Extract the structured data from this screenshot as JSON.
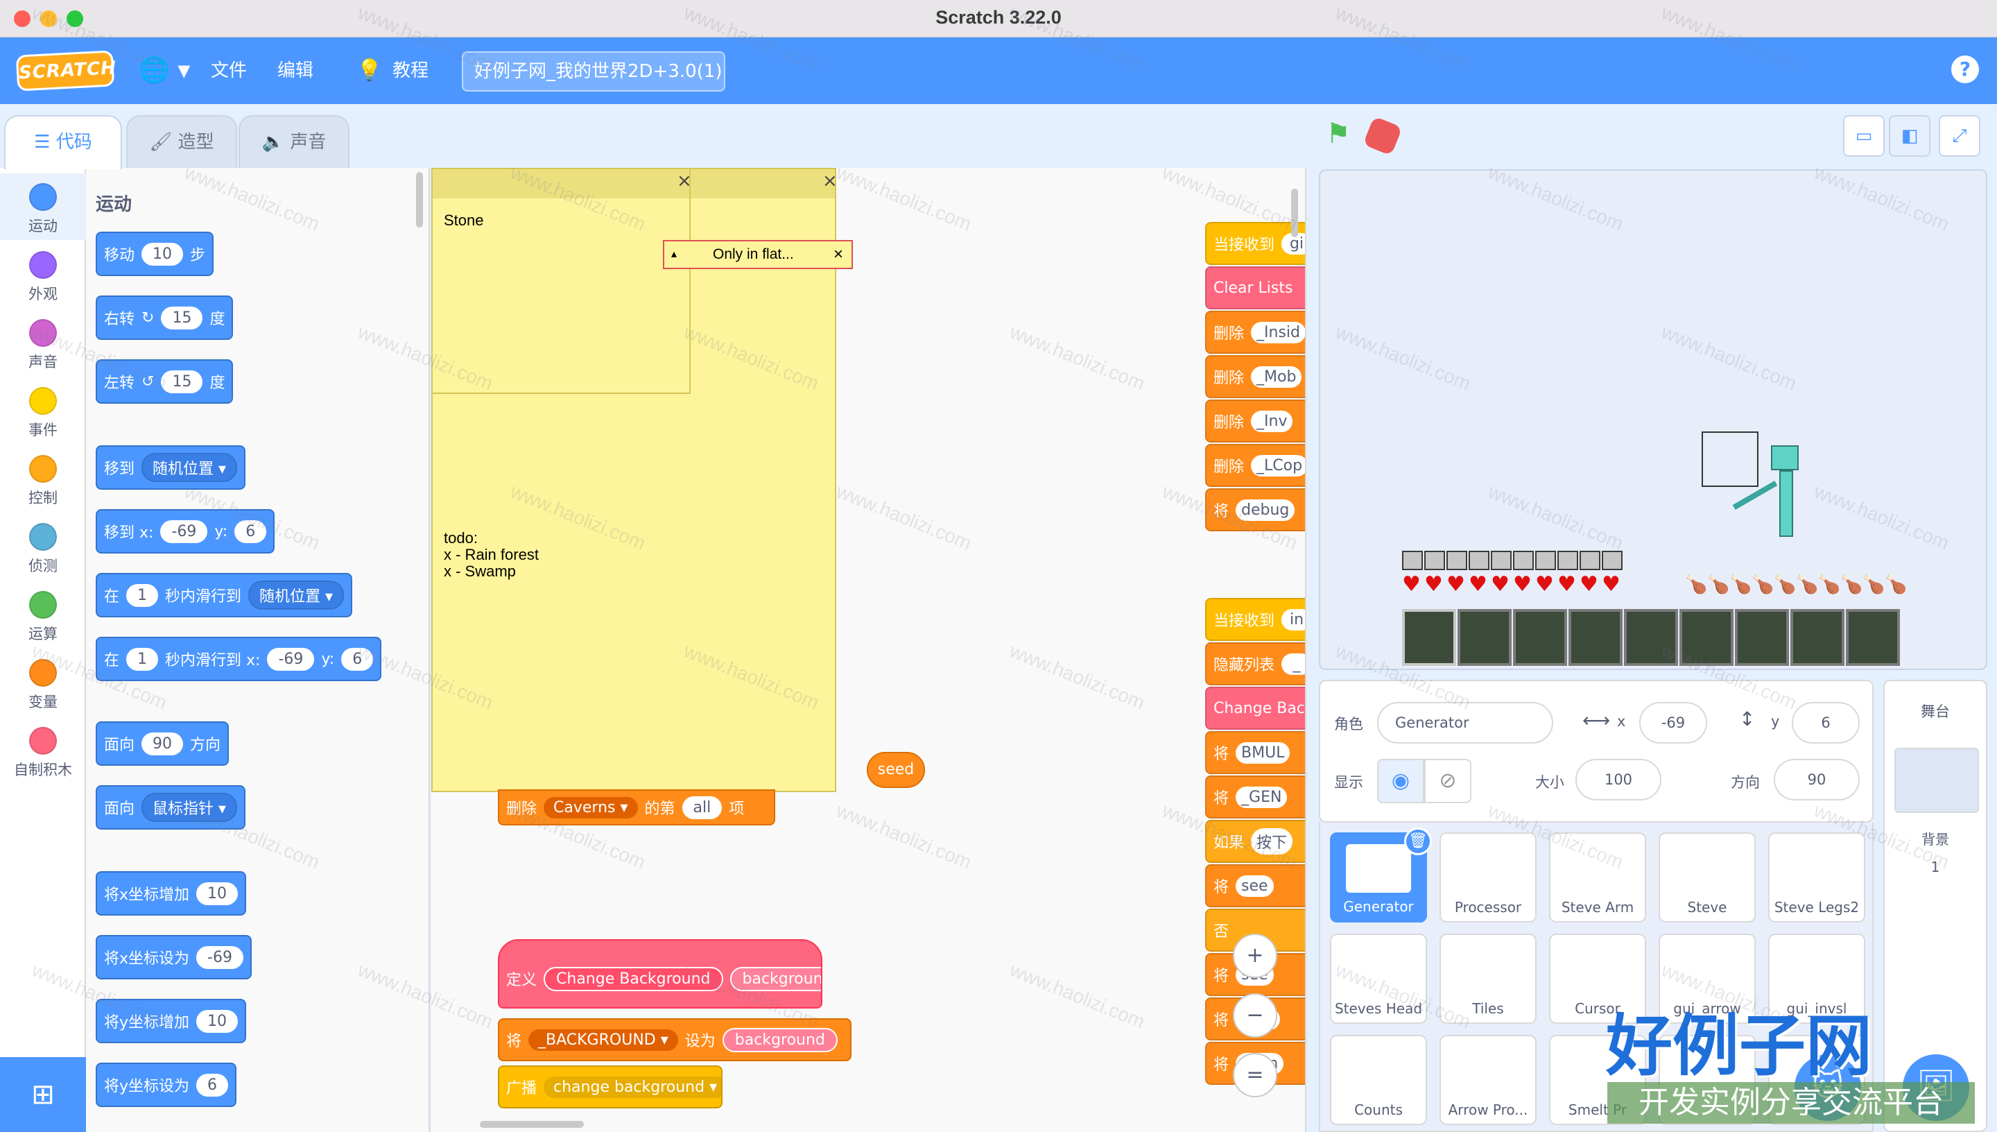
{
  "window": {
    "title": "Scratch 3.22.0"
  },
  "menubar": {
    "logo": "SCRATCH",
    "file": "文件",
    "edit": "编辑",
    "tutorials": "教程",
    "project_title": "好例子网_我的世界2D+3.0(1)",
    "help": "?"
  },
  "tabs": {
    "code": "代码",
    "costumes": "造型",
    "sounds": "声音"
  },
  "categories": [
    {
      "label": "运动",
      "color": "#4c97ff"
    },
    {
      "label": "外观",
      "color": "#9966ff"
    },
    {
      "label": "声音",
      "color": "#cf63cf"
    },
    {
      "label": "事件",
      "color": "#ffd500"
    },
    {
      "label": "控制",
      "color": "#ffab19"
    },
    {
      "label": "侦测",
      "color": "#5cb1d6"
    },
    {
      "label": "运算",
      "color": "#59c059"
    },
    {
      "label": "变量",
      "color": "#ff8c1a"
    },
    {
      "label": "自制积木",
      "color": "#ff6680"
    }
  ],
  "palette": {
    "title": "运动",
    "move": {
      "a": "移动",
      "v": "10",
      "b": "步"
    },
    "turn_right": {
      "a": "右转",
      "v": "15",
      "b": "度"
    },
    "turn_left": {
      "a": "左转",
      "v": "15",
      "b": "度"
    },
    "goto": {
      "a": "移到",
      "dd": "随机位置"
    },
    "goto_xy": {
      "a": "移到 x:",
      "x": "-69",
      "b": "y:",
      "y": "6"
    },
    "glide": {
      "a": "在",
      "v": "1",
      "b": "秒内滑行到",
      "dd": "随机位置"
    },
    "glide_xy": {
      "a": "在",
      "v": "1",
      "b": "秒内滑行到 x:",
      "x": "-69",
      "c": "y:",
      "y": "6"
    },
    "point_dir": {
      "a": "面向",
      "v": "90",
      "b": "方向"
    },
    "point_towards": {
      "a": "面向",
      "dd": "鼠标指针"
    },
    "change_x": {
      "a": "将x坐标增加",
      "v": "10"
    },
    "set_x": {
      "a": "将x坐标设为",
      "v": "-69"
    },
    "change_y": {
      "a": "将y坐标增加",
      "v": "10"
    },
    "set_y": {
      "a": "将y坐标设为",
      "v": "6"
    }
  },
  "script": {
    "note1": "Stone",
    "note2": "todo:\nx - Rain forest\nx - Swamp",
    "note_small": "Only in flat...",
    "delete_block": {
      "a": "删除",
      "dd": "Caverns",
      "b": "的第",
      "v": "all",
      "c": "项"
    },
    "seed": "seed",
    "define": {
      "a": "定义",
      "name": "Change Background",
      "arg": "background"
    },
    "set_bg": {
      "a": "将",
      "dd": "_BACKGROUND",
      "b": "设为",
      "v": "background"
    },
    "broadcast": {
      "a": "广播",
      "dd": "change background"
    },
    "right_stack1": [
      "当接收到",
      "Clear Lists",
      "删除",
      "删除",
      "删除",
      "删除",
      "将"
    ],
    "right_stack1_args": [
      "gi",
      "",
      "_Insid",
      "_Mob",
      "_Inv",
      "_LCop",
      "debug"
    ],
    "right_stack2": [
      "当接收到",
      "隐藏列表",
      "Change Back",
      "将",
      "将",
      "如果",
      "将",
      "否",
      "将",
      "将",
      "将"
    ],
    "right_stack2_args": [
      "in",
      "_",
      "",
      "BMUL",
      "_GEN",
      "按下",
      "see",
      "",
      "see",
      "CHU",
      "_Ran"
    ],
    "zoom_in": "+",
    "zoom_out": "−",
    "zoom_reset": "="
  },
  "sprite_info": {
    "sprite_label": "角色",
    "sprite_name": "Generator",
    "x_label": "x",
    "x": "-69",
    "y_label": "y",
    "y": "6",
    "show_label": "显示",
    "size_label": "大小",
    "size": "100",
    "direction_label": "方向",
    "direction": "90"
  },
  "sprites": [
    "Generator",
    "Processor",
    "Steve Arm",
    "Steve",
    "Steve Legs2",
    "Steves Head",
    "Tiles",
    "Cursor",
    "gui_arrow",
    "gui_invsl",
    "Counts",
    "Arrow Pro...",
    "Smelt Pr",
    "",
    ""
  ],
  "stage_panel": {
    "title": "舞台",
    "backdrop_label": "背景",
    "backdrop_count": "1"
  },
  "watermark": {
    "site": "www.haolizi.com",
    "brand": "好例子网",
    "slogan": "开发实例分享交流平台"
  },
  "colors": {
    "menubar": "#4c97ff",
    "motion": "#4c97ff",
    "variables": "#ff8c1a",
    "custom": "#ff6680",
    "events": "#ffbf00"
  }
}
